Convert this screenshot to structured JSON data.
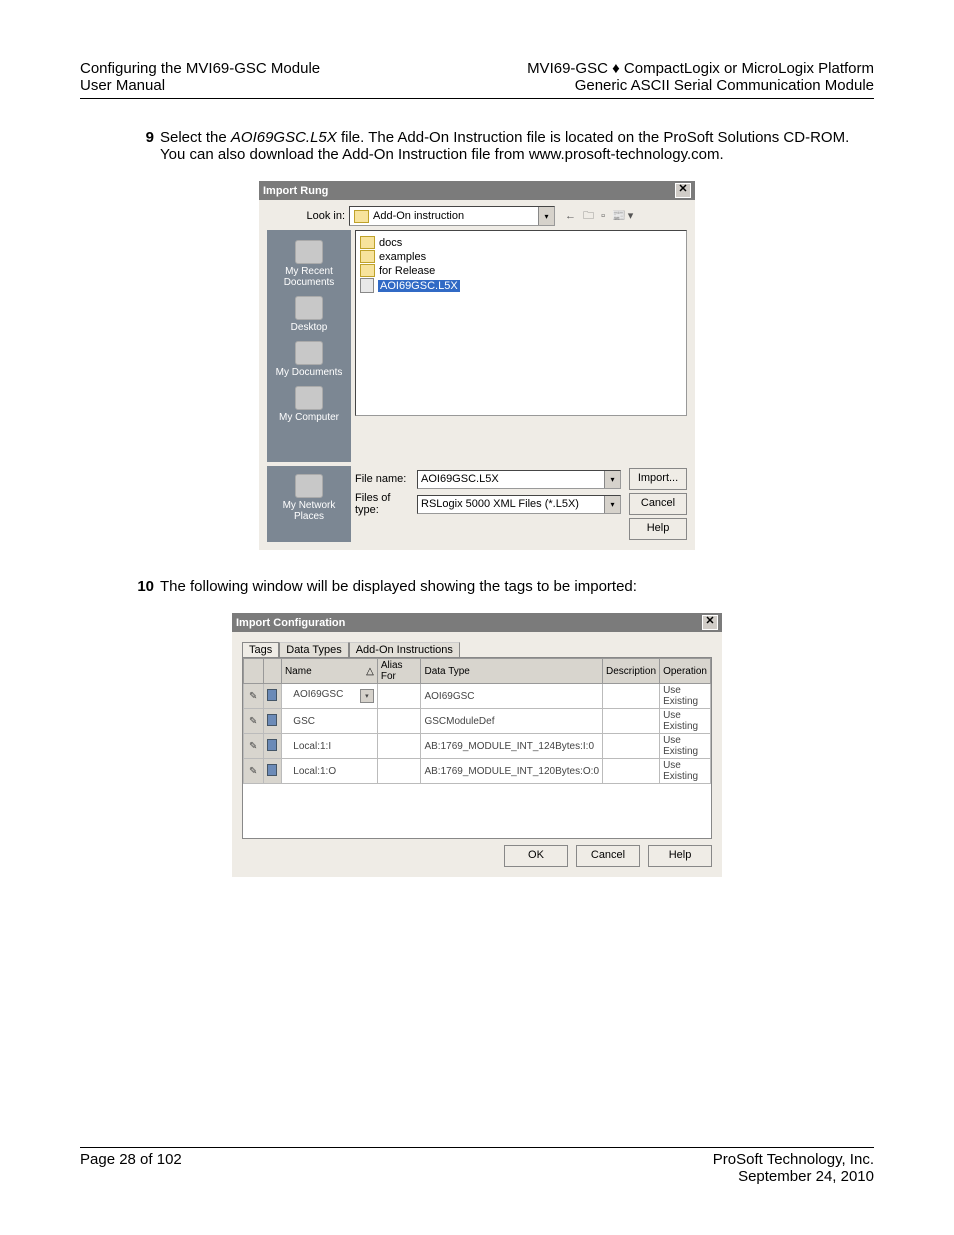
{
  "header": {
    "left_line1": "Configuring the MVI69-GSC Module",
    "left_line2": "User Manual",
    "right_line1": "MVI69-GSC ♦ CompactLogix or MicroLogix Platform",
    "right_line2": "Generic ASCII Serial Communication Module"
  },
  "steps": {
    "s9_num": "9",
    "s9_a": "Select the ",
    "s9_file": "AOI69GSC.L5X",
    "s9_b": " file. The Add-On Instruction file is located on the ProSoft Solutions CD-ROM. You can also download the Add-On Instruction file from www.prosoft-technology.com.",
    "s10_num": "10",
    "s10_text": "The following window will be displayed showing the tags to be imported:"
  },
  "dlg1": {
    "title": "Import Rung",
    "lookin_label": "Look in:",
    "lookin_value": "Add-On instruction",
    "toolbar_glyphs": "←  🗀 ▫ 📰▾",
    "places": {
      "recent": "My Recent Documents",
      "desktop": "Desktop",
      "mydocs": "My Documents",
      "mycomp": "My Computer",
      "mynet": "My Network Places"
    },
    "files": {
      "docs": "docs",
      "examples": "examples",
      "forrelease": "for Release",
      "selected": "AOI69GSC.L5X"
    },
    "filename_label": "File name:",
    "filename_value": "AOI69GSC.L5X",
    "filetype_label": "Files of type:",
    "filetype_value": "RSLogix 5000 XML Files (*.L5X)",
    "btn_import": "Import...",
    "btn_cancel": "Cancel",
    "btn_help": "Help"
  },
  "dlg2": {
    "title": "Import Configuration",
    "tabs": {
      "tags": "Tags",
      "datatypes": "Data Types",
      "aoi": "Add-On Instructions"
    },
    "cols": {
      "icon": "",
      "p": "",
      "name": "Name",
      "sort": "△",
      "alias": "Alias For",
      "dtype": "Data Type",
      "desc": "Description",
      "op": "Operation"
    },
    "rows": [
      {
        "name": "AOI69GSC",
        "dtype": "AOI69GSC",
        "op": "Use Existing",
        "drop": true
      },
      {
        "name": "GSC",
        "dtype": "GSCModuleDef",
        "op": "Use Existing",
        "drop": false
      },
      {
        "name": "Local:1:I",
        "dtype": "AB:1769_MODULE_INT_124Bytes:I:0",
        "op": "Use Existing",
        "drop": false
      },
      {
        "name": "Local:1:O",
        "dtype": "AB:1769_MODULE_INT_120Bytes:O:0",
        "op": "Use Existing",
        "drop": false
      }
    ],
    "btn_ok": "OK",
    "btn_cancel": "Cancel",
    "btn_help": "Help"
  },
  "footer": {
    "left": "Page 28 of 102",
    "right_line1": "ProSoft Technology, Inc.",
    "right_line2": "September 24, 2010"
  }
}
